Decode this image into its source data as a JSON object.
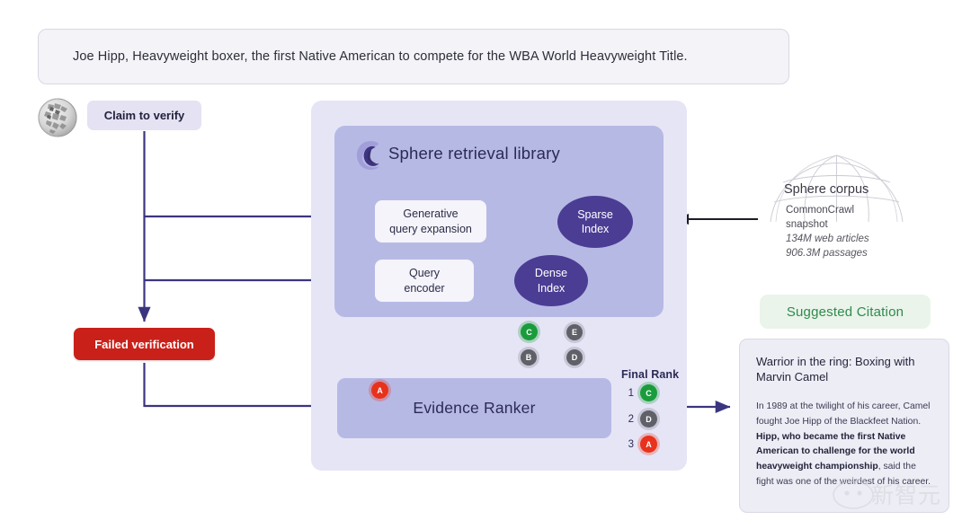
{
  "claim_banner": {
    "text": "Joe Hipp, Heavyweight boxer, the first Native American to compete for the WBA World Heavyweight Title."
  },
  "source": {
    "icon": "wikipedia-globe-icon"
  },
  "claim_pill": {
    "label": "Claim to verify"
  },
  "failed": {
    "label": "Failed verification",
    "color": "#c9211a"
  },
  "sphere_system": {
    "title": "Sphere retrieval library",
    "logo_icon": "sphere-s-logo-icon",
    "boxes": [
      {
        "id": "generative-query-expansion",
        "line1": "Generative",
        "line2": "query expansion"
      },
      {
        "id": "query-encoder",
        "line1": "Query",
        "line2": "encoder"
      }
    ],
    "indexes": [
      {
        "id": "sparse-index",
        "line1": "Sparse",
        "line2": "Index",
        "color": "#4a3d93"
      },
      {
        "id": "dense-index",
        "line1": "Dense",
        "line2": "Index",
        "color": "#4a3d93"
      }
    ],
    "ranker": {
      "label": "Evidence Ranker"
    },
    "retrieved_badges": [
      {
        "letter": "C",
        "color": "green"
      },
      {
        "letter": "E",
        "color": "grey"
      },
      {
        "letter": "B",
        "color": "grey"
      },
      {
        "letter": "D",
        "color": "grey"
      }
    ],
    "ranker_input_badge": {
      "letter": "A",
      "color": "red"
    },
    "final_rank": {
      "label": "Final Rank",
      "rows": [
        {
          "rank": "1",
          "letter": "C",
          "color": "green"
        },
        {
          "rank": "2",
          "letter": "D",
          "color": "grey"
        },
        {
          "rank": "3",
          "letter": "A",
          "color": "red"
        }
      ]
    }
  },
  "corpus": {
    "title": "Sphere corpus",
    "line1": "CommonCrawl",
    "line2": "snapshot",
    "stat1": "134M web articles",
    "stat2": "906.3M passages"
  },
  "suggested_citation": {
    "pill_label": "Suggested Citation",
    "accent": "#2f8a4e",
    "card_title": "Warrior in the ring: Boxing with Marvin Camel",
    "body_pre": "In 1989 at the twilight of his career, Camel fought Joe Hipp of the Blackfeet Nation. ",
    "body_bold": "Hipp, who became the first Native American to challenge for the world heavyweight championship",
    "body_post": ", said the fight was one of the weirdest of his career."
  },
  "watermark": {
    "text": "新智元"
  },
  "theme": {
    "panel_outer": "#e6e5f6",
    "panel_inner": "#b7b9e5",
    "index_fill": "#4a3d93",
    "arrow": "#3b3580",
    "claim_pill": "#e4e2f3"
  }
}
